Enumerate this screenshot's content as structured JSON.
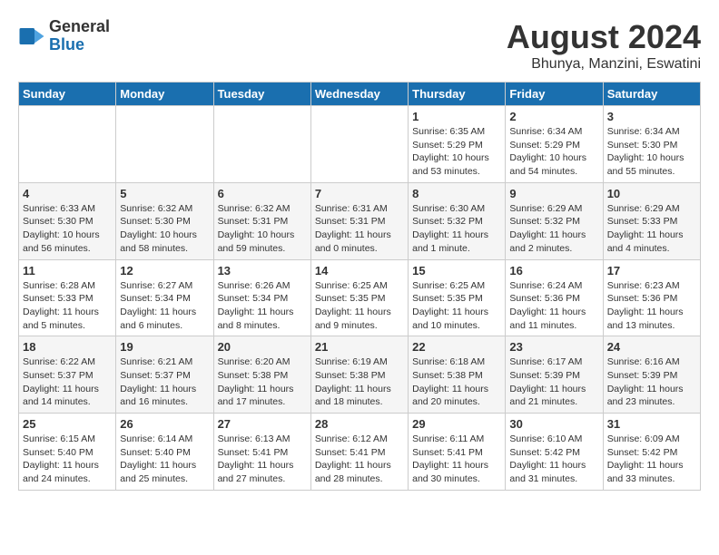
{
  "header": {
    "logo_general": "General",
    "logo_blue": "Blue",
    "month_title": "August 2024",
    "location": "Bhunya, Manzini, Eswatini"
  },
  "days_of_week": [
    "Sunday",
    "Monday",
    "Tuesday",
    "Wednesday",
    "Thursday",
    "Friday",
    "Saturday"
  ],
  "weeks": [
    [
      {
        "day": "",
        "info": ""
      },
      {
        "day": "",
        "info": ""
      },
      {
        "day": "",
        "info": ""
      },
      {
        "day": "",
        "info": ""
      },
      {
        "day": "1",
        "info": "Sunrise: 6:35 AM\nSunset: 5:29 PM\nDaylight: 10 hours and 53 minutes."
      },
      {
        "day": "2",
        "info": "Sunrise: 6:34 AM\nSunset: 5:29 PM\nDaylight: 10 hours and 54 minutes."
      },
      {
        "day": "3",
        "info": "Sunrise: 6:34 AM\nSunset: 5:30 PM\nDaylight: 10 hours and 55 minutes."
      }
    ],
    [
      {
        "day": "4",
        "info": "Sunrise: 6:33 AM\nSunset: 5:30 PM\nDaylight: 10 hours and 56 minutes."
      },
      {
        "day": "5",
        "info": "Sunrise: 6:32 AM\nSunset: 5:30 PM\nDaylight: 10 hours and 58 minutes."
      },
      {
        "day": "6",
        "info": "Sunrise: 6:32 AM\nSunset: 5:31 PM\nDaylight: 10 hours and 59 minutes."
      },
      {
        "day": "7",
        "info": "Sunrise: 6:31 AM\nSunset: 5:31 PM\nDaylight: 11 hours and 0 minutes."
      },
      {
        "day": "8",
        "info": "Sunrise: 6:30 AM\nSunset: 5:32 PM\nDaylight: 11 hours and 1 minute."
      },
      {
        "day": "9",
        "info": "Sunrise: 6:29 AM\nSunset: 5:32 PM\nDaylight: 11 hours and 2 minutes."
      },
      {
        "day": "10",
        "info": "Sunrise: 6:29 AM\nSunset: 5:33 PM\nDaylight: 11 hours and 4 minutes."
      }
    ],
    [
      {
        "day": "11",
        "info": "Sunrise: 6:28 AM\nSunset: 5:33 PM\nDaylight: 11 hours and 5 minutes."
      },
      {
        "day": "12",
        "info": "Sunrise: 6:27 AM\nSunset: 5:34 PM\nDaylight: 11 hours and 6 minutes."
      },
      {
        "day": "13",
        "info": "Sunrise: 6:26 AM\nSunset: 5:34 PM\nDaylight: 11 hours and 8 minutes."
      },
      {
        "day": "14",
        "info": "Sunrise: 6:25 AM\nSunset: 5:35 PM\nDaylight: 11 hours and 9 minutes."
      },
      {
        "day": "15",
        "info": "Sunrise: 6:25 AM\nSunset: 5:35 PM\nDaylight: 11 hours and 10 minutes."
      },
      {
        "day": "16",
        "info": "Sunrise: 6:24 AM\nSunset: 5:36 PM\nDaylight: 11 hours and 11 minutes."
      },
      {
        "day": "17",
        "info": "Sunrise: 6:23 AM\nSunset: 5:36 PM\nDaylight: 11 hours and 13 minutes."
      }
    ],
    [
      {
        "day": "18",
        "info": "Sunrise: 6:22 AM\nSunset: 5:37 PM\nDaylight: 11 hours and 14 minutes."
      },
      {
        "day": "19",
        "info": "Sunrise: 6:21 AM\nSunset: 5:37 PM\nDaylight: 11 hours and 16 minutes."
      },
      {
        "day": "20",
        "info": "Sunrise: 6:20 AM\nSunset: 5:38 PM\nDaylight: 11 hours and 17 minutes."
      },
      {
        "day": "21",
        "info": "Sunrise: 6:19 AM\nSunset: 5:38 PM\nDaylight: 11 hours and 18 minutes."
      },
      {
        "day": "22",
        "info": "Sunrise: 6:18 AM\nSunset: 5:38 PM\nDaylight: 11 hours and 20 minutes."
      },
      {
        "day": "23",
        "info": "Sunrise: 6:17 AM\nSunset: 5:39 PM\nDaylight: 11 hours and 21 minutes."
      },
      {
        "day": "24",
        "info": "Sunrise: 6:16 AM\nSunset: 5:39 PM\nDaylight: 11 hours and 23 minutes."
      }
    ],
    [
      {
        "day": "25",
        "info": "Sunrise: 6:15 AM\nSunset: 5:40 PM\nDaylight: 11 hours and 24 minutes."
      },
      {
        "day": "26",
        "info": "Sunrise: 6:14 AM\nSunset: 5:40 PM\nDaylight: 11 hours and 25 minutes."
      },
      {
        "day": "27",
        "info": "Sunrise: 6:13 AM\nSunset: 5:41 PM\nDaylight: 11 hours and 27 minutes."
      },
      {
        "day": "28",
        "info": "Sunrise: 6:12 AM\nSunset: 5:41 PM\nDaylight: 11 hours and 28 minutes."
      },
      {
        "day": "29",
        "info": "Sunrise: 6:11 AM\nSunset: 5:41 PM\nDaylight: 11 hours and 30 minutes."
      },
      {
        "day": "30",
        "info": "Sunrise: 6:10 AM\nSunset: 5:42 PM\nDaylight: 11 hours and 31 minutes."
      },
      {
        "day": "31",
        "info": "Sunrise: 6:09 AM\nSunset: 5:42 PM\nDaylight: 11 hours and 33 minutes."
      }
    ]
  ]
}
